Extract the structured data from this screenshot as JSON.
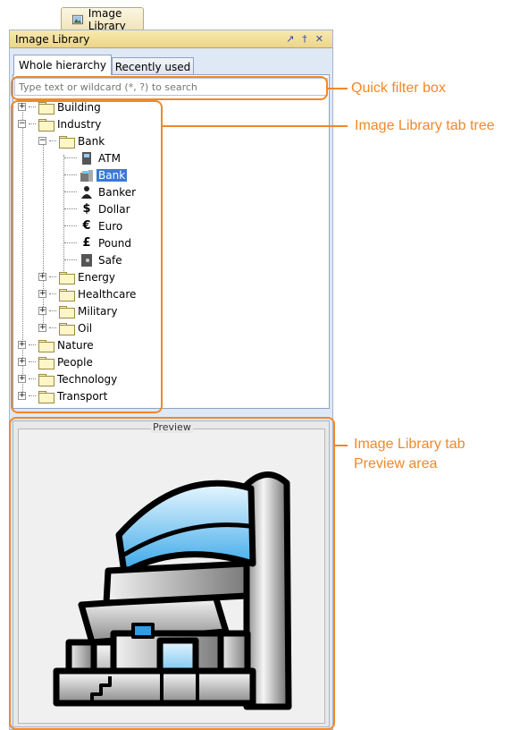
{
  "window_tab": {
    "label": "Image Library",
    "icon": "image-icon"
  },
  "panel": {
    "title": "Image Library",
    "buttons": [
      "float-icon",
      "pin-icon",
      "close-icon"
    ]
  },
  "tabs": [
    {
      "label": "Whole hierarchy",
      "active": true
    },
    {
      "label": "Recently used",
      "active": false
    }
  ],
  "search": {
    "placeholder": "Type text or wildcard (*, ?) to search",
    "value": ""
  },
  "tree": {
    "building": "Building",
    "industry": "Industry",
    "bank": "Bank",
    "atm": "ATM",
    "bank_item": "Bank",
    "banker": "Banker",
    "dollar": "Dollar",
    "euro": "Euro",
    "pound": "Pound",
    "safe": "Safe",
    "energy": "Energy",
    "healthcare": "Healthcare",
    "military": "Military",
    "oil": "Oil",
    "nature": "Nature",
    "people": "People",
    "technology": "Technology",
    "transport": "Transport",
    "selected": "Bank"
  },
  "preview": {
    "title": "Preview",
    "image": "bank-building-illustration"
  },
  "callouts": {
    "filter": "Quick filter box",
    "tree": "Image Library tab tree",
    "preview_line1": "Image Library tab",
    "preview_line2": "Preview area"
  },
  "colors": {
    "accent": "#f0882a",
    "selection": "#3a78d8",
    "header": "#ecd58a"
  }
}
